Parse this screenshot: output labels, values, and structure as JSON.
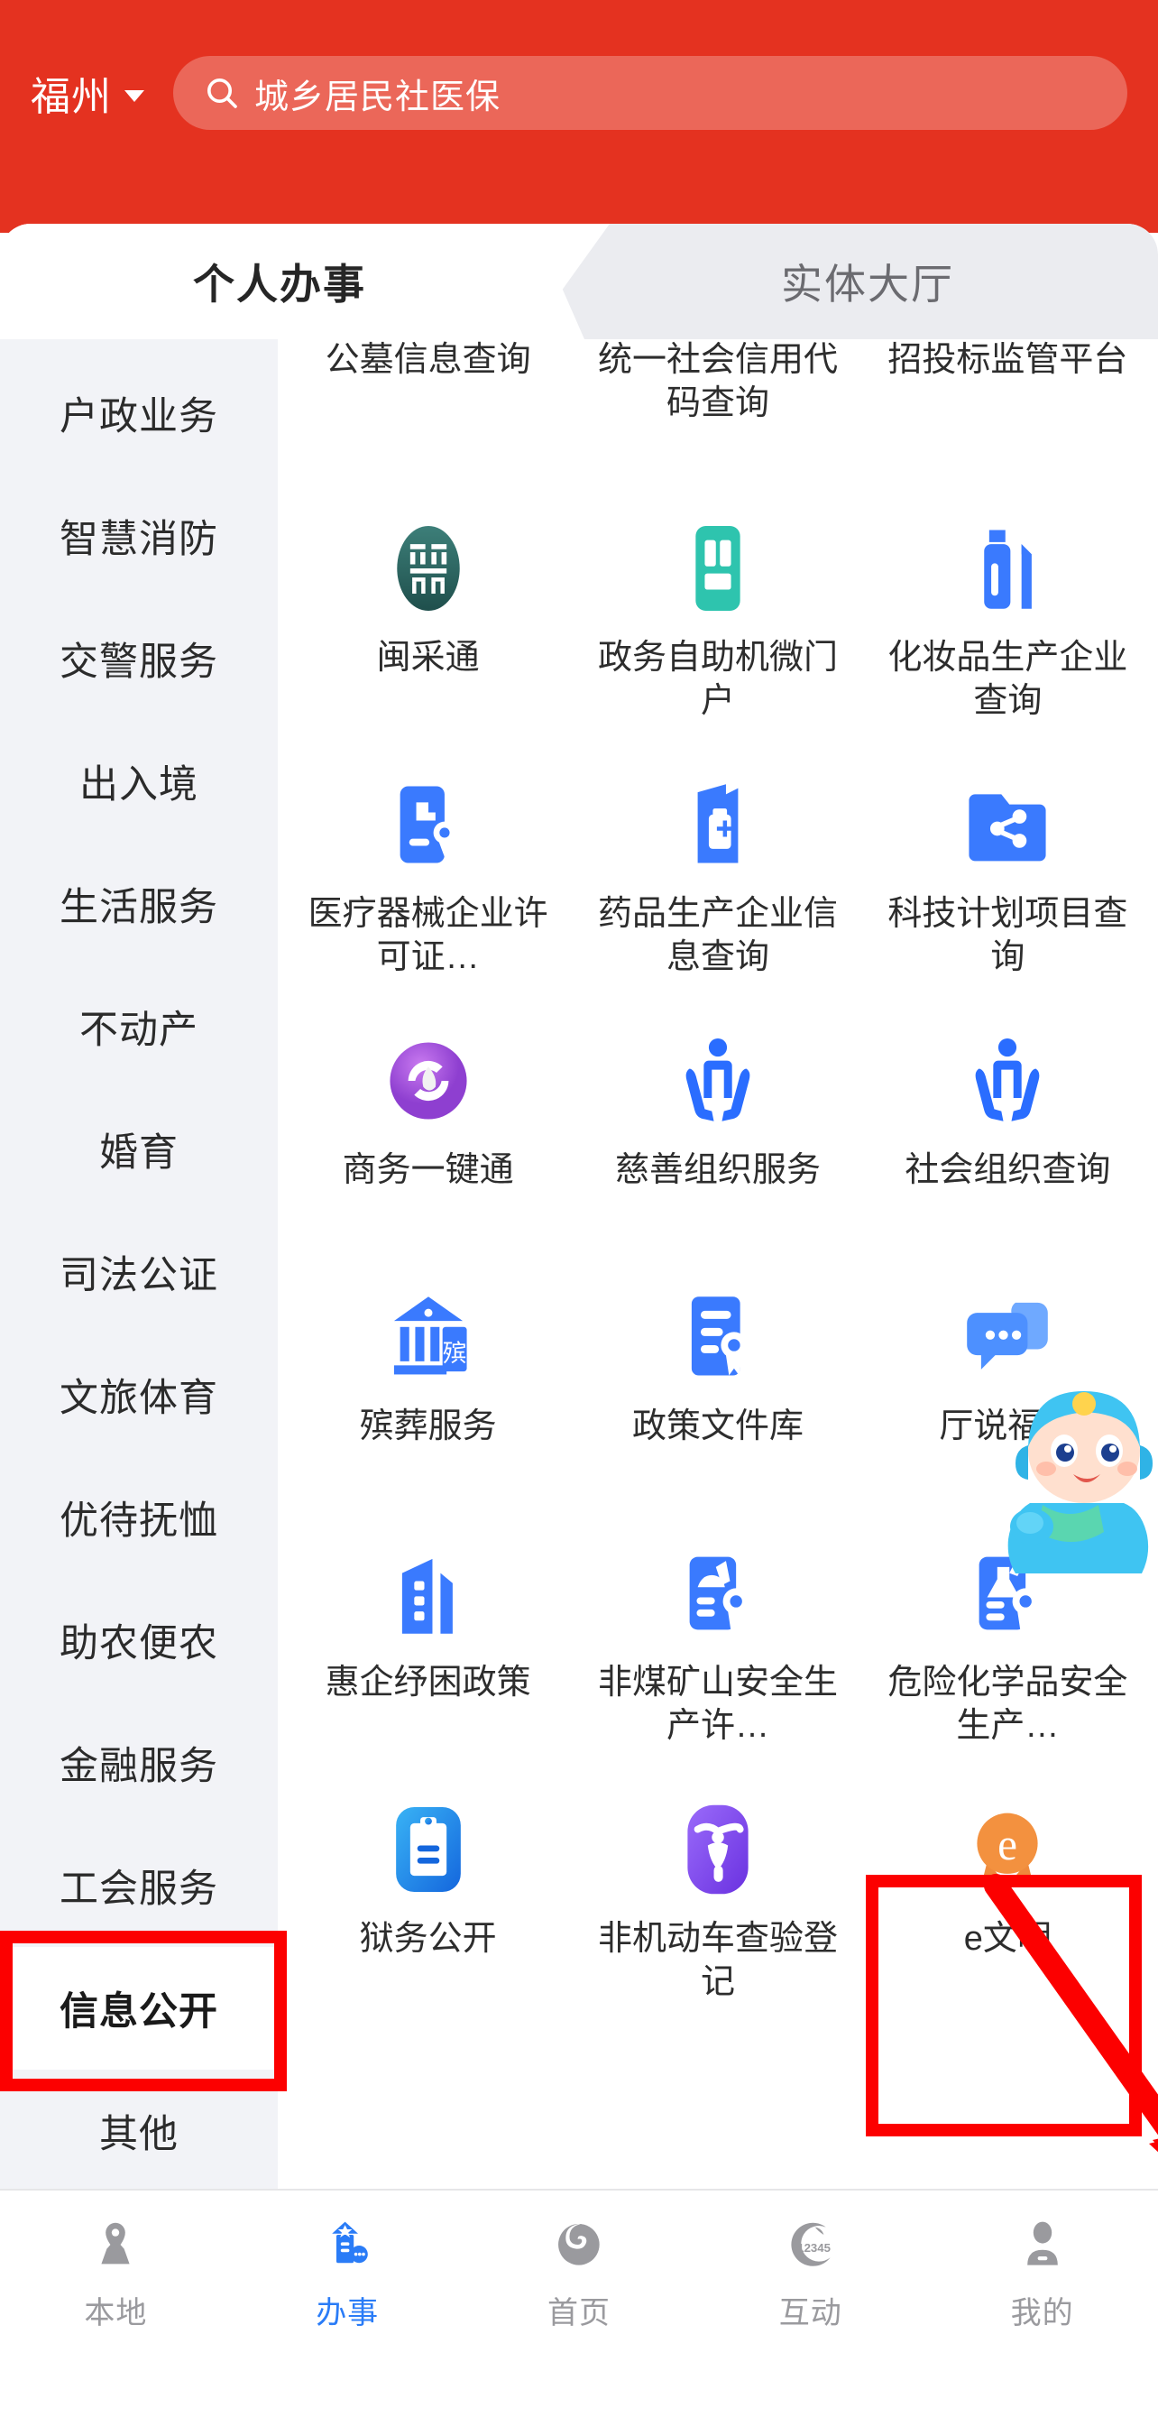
{
  "header": {
    "city": "福州",
    "city_caret_icon": "chevron-down-icon",
    "search_icon": "search-icon",
    "search_value": "城乡居民社医保"
  },
  "tabs": [
    {
      "label": "个人办事",
      "active": true
    },
    {
      "label": "实体大厅",
      "active": false
    }
  ],
  "sidebar": {
    "items": [
      {
        "label": "户政业务",
        "active": false
      },
      {
        "label": "智慧消防",
        "active": false
      },
      {
        "label": "交警服务",
        "active": false
      },
      {
        "label": "出入境",
        "active": false
      },
      {
        "label": "生活服务",
        "active": false
      },
      {
        "label": "不动产",
        "active": false
      },
      {
        "label": "婚育",
        "active": false
      },
      {
        "label": "司法公证",
        "active": false
      },
      {
        "label": "文旅体育",
        "active": false
      },
      {
        "label": "优待抚恤",
        "active": false
      },
      {
        "label": "助农便农",
        "active": false
      },
      {
        "label": "金融服务",
        "active": false
      },
      {
        "label": "工会服务",
        "active": false
      },
      {
        "label": "信息公开",
        "active": true
      },
      {
        "label": "其他",
        "active": false
      }
    ]
  },
  "grid": {
    "items": [
      {
        "label": "公墓信息查询",
        "icon": "tombstone-icon",
        "icon_color": "#2f6f6b",
        "label_only": true
      },
      {
        "label": "统一社会信用代码查询",
        "icon": "credit-code-icon",
        "icon_color": "#2ec4ae",
        "label_only": true
      },
      {
        "label": "招投标监管平台",
        "icon": "bidding-icon",
        "icon_color": "#3a7afe",
        "label_only": true
      },
      {
        "label": "闽采通",
        "icon": "mincaitong-icon",
        "icon_color": "#2f6f6b"
      },
      {
        "label": "政务自助机微门户",
        "icon": "kiosk-icon",
        "icon_color": "#2ec4ae"
      },
      {
        "label": "化妆品生产企业查询",
        "icon": "cosmetics-icon",
        "icon_color": "#3a7afe"
      },
      {
        "label": "医疗器械企业许可证…",
        "icon": "medical-device-license-icon",
        "icon_color": "#3a7afe"
      },
      {
        "label": "药品生产企业信息查询",
        "icon": "drug-factory-icon",
        "icon_color": "#3a7afe"
      },
      {
        "label": "科技计划项目查询",
        "icon": "science-folder-icon",
        "icon_color": "#3a7afe"
      },
      {
        "label": "商务一键通",
        "icon": "commerce-onekey-icon",
        "icon_color": "#a54fd8"
      },
      {
        "label": "慈善组织服务",
        "icon": "charity-hands-icon",
        "icon_color": "#2a6dff"
      },
      {
        "label": "社会组织查询",
        "icon": "social-org-hands-icon",
        "icon_color": "#2a6dff"
      },
      {
        "label": "殡葬服务",
        "icon": "funeral-hall-icon",
        "icon_color": "#3a7afe"
      },
      {
        "label": "政策文件库",
        "icon": "policy-doc-icon",
        "icon_color": "#3a7afe"
      },
      {
        "label": "厅说福建",
        "icon": "chat-bubbles-icon",
        "icon_color": "#4d90ff"
      },
      {
        "label": "惠企纾困政策",
        "icon": "enterprise-building-icon",
        "icon_color": "#3a7afe"
      },
      {
        "label": "非煤矿山安全生产许…",
        "icon": "mine-safety-license-icon",
        "icon_color": "#3a7afe"
      },
      {
        "label": "危险化学品安全生产…",
        "icon": "hazchem-license-icon",
        "icon_color": "#3a7afe"
      },
      {
        "label": "狱务公开",
        "icon": "prison-clipboard-icon",
        "icon_color": "#1e90ff"
      },
      {
        "label": "非机动车查验登记",
        "icon": "ebike-icon",
        "icon_color": "#7b4df0"
      },
      {
        "label": "e文明",
        "icon": "e-civilization-medal-icon",
        "icon_color": "#f3913f"
      }
    ]
  },
  "annotations": {
    "highlight_color": "#fc0000",
    "boxes": [
      "信息公开",
      "e文明"
    ],
    "arrow": "red-arrow-pointing-to-e文明"
  },
  "bottom_nav": {
    "items": [
      {
        "label": "本地",
        "icon": "location-pin-icon",
        "active": false
      },
      {
        "label": "办事",
        "icon": "service-building-icon",
        "active": true
      },
      {
        "label": "首页",
        "icon": "home-spiral-icon",
        "active": false
      },
      {
        "label": "互动",
        "icon": "hotline-12345-icon",
        "active": false
      },
      {
        "label": "我的",
        "icon": "user-profile-icon",
        "active": false
      }
    ],
    "hotline_number": "12345"
  }
}
